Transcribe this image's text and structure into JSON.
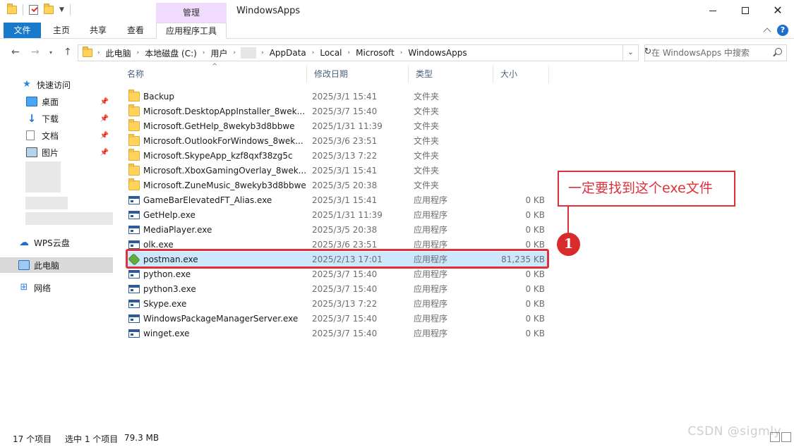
{
  "window": {
    "title": "WindowsApps",
    "context_tab_label": "管理"
  },
  "ribbon": {
    "tabs": [
      "文件",
      "主页",
      "共享",
      "查看",
      "应用程序工具"
    ]
  },
  "address": {
    "crumbs": [
      "此电脑",
      "本地磁盘 (C:)",
      "用户",
      "AppData",
      "Local",
      "Microsoft",
      "WindowsApps"
    ],
    "search_placeholder": "在 WindowsApps 中搜索"
  },
  "nav": {
    "quick_access": "快速访问",
    "items": [
      {
        "label": "桌面",
        "icon": "desktop-icon",
        "pinned": true
      },
      {
        "label": "下载",
        "icon": "download-icon",
        "pinned": true
      },
      {
        "label": "文档",
        "icon": "document-icon",
        "pinned": true
      },
      {
        "label": "图片",
        "icon": "pictures-icon",
        "pinned": true
      }
    ],
    "wps": "WPS云盘",
    "this_pc": "此电脑",
    "network": "网络"
  },
  "columns": {
    "name": "名称",
    "date": "修改日期",
    "type": "类型",
    "size": "大小"
  },
  "files": [
    {
      "name": "Backup",
      "date": "2025/3/1 15:41",
      "type": "文件夹",
      "size": "",
      "icon": "folder-icon"
    },
    {
      "name": "Microsoft.DesktopAppInstaller_8wek...",
      "date": "2025/3/7 15:40",
      "type": "文件夹",
      "size": "",
      "icon": "folder-icon"
    },
    {
      "name": "Microsoft.GetHelp_8wekyb3d8bbwe",
      "date": "2025/1/31 11:39",
      "type": "文件夹",
      "size": "",
      "icon": "folder-icon"
    },
    {
      "name": "Microsoft.OutlookForWindows_8wek...",
      "date": "2025/3/6 23:51",
      "type": "文件夹",
      "size": "",
      "icon": "folder-icon"
    },
    {
      "name": "Microsoft.SkypeApp_kzf8qxf38zg5c",
      "date": "2025/3/13 7:22",
      "type": "文件夹",
      "size": "",
      "icon": "folder-icon"
    },
    {
      "name": "Microsoft.XboxGamingOverlay_8wek...",
      "date": "2025/3/1 15:41",
      "type": "文件夹",
      "size": "",
      "icon": "folder-icon"
    },
    {
      "name": "Microsoft.ZuneMusic_8wekyb3d8bbwe",
      "date": "2025/3/5 20:38",
      "type": "文件夹",
      "size": "",
      "icon": "folder-icon"
    },
    {
      "name": "GameBarElevatedFT_Alias.exe",
      "date": "2025/3/1 15:41",
      "type": "应用程序",
      "size": "0 KB",
      "icon": "exe-icon"
    },
    {
      "name": "GetHelp.exe",
      "date": "2025/1/31 11:39",
      "type": "应用程序",
      "size": "0 KB",
      "icon": "exe-icon"
    },
    {
      "name": "MediaPlayer.exe",
      "date": "2025/3/5 20:38",
      "type": "应用程序",
      "size": "0 KB",
      "icon": "exe-icon"
    },
    {
      "name": "olk.exe",
      "date": "2025/3/6 23:51",
      "type": "应用程序",
      "size": "0 KB",
      "icon": "exe-icon"
    },
    {
      "name": "postman.exe",
      "date": "2025/2/13 17:01",
      "type": "应用程序",
      "size": "81,235 KB",
      "icon": "postman-icon",
      "selected": true
    },
    {
      "name": "python.exe",
      "date": "2025/3/7 15:40",
      "type": "应用程序",
      "size": "0 KB",
      "icon": "exe-icon"
    },
    {
      "name": "python3.exe",
      "date": "2025/3/7 15:40",
      "type": "应用程序",
      "size": "0 KB",
      "icon": "exe-icon"
    },
    {
      "name": "Skype.exe",
      "date": "2025/3/13 7:22",
      "type": "应用程序",
      "size": "0 KB",
      "icon": "exe-icon"
    },
    {
      "name": "WindowsPackageManagerServer.exe",
      "date": "2025/3/7 15:40",
      "type": "应用程序",
      "size": "0 KB",
      "icon": "exe-icon"
    },
    {
      "name": "winget.exe",
      "date": "2025/3/7 15:40",
      "type": "应用程序",
      "size": "0 KB",
      "icon": "exe-icon"
    }
  ],
  "annotation": {
    "callout_text": "一定要找到这个exe文件",
    "badge_number": "1",
    "color": "#e0313a"
  },
  "status": {
    "item_count": "17 个项目",
    "selection": "选中 1 个项目",
    "selection_size": "79.3 MB"
  },
  "watermark": "CSDN @sigmly",
  "colors": {
    "accent": "#1979ca",
    "selected_row": "#cce8ff",
    "context_tab": "#f1dcff"
  }
}
